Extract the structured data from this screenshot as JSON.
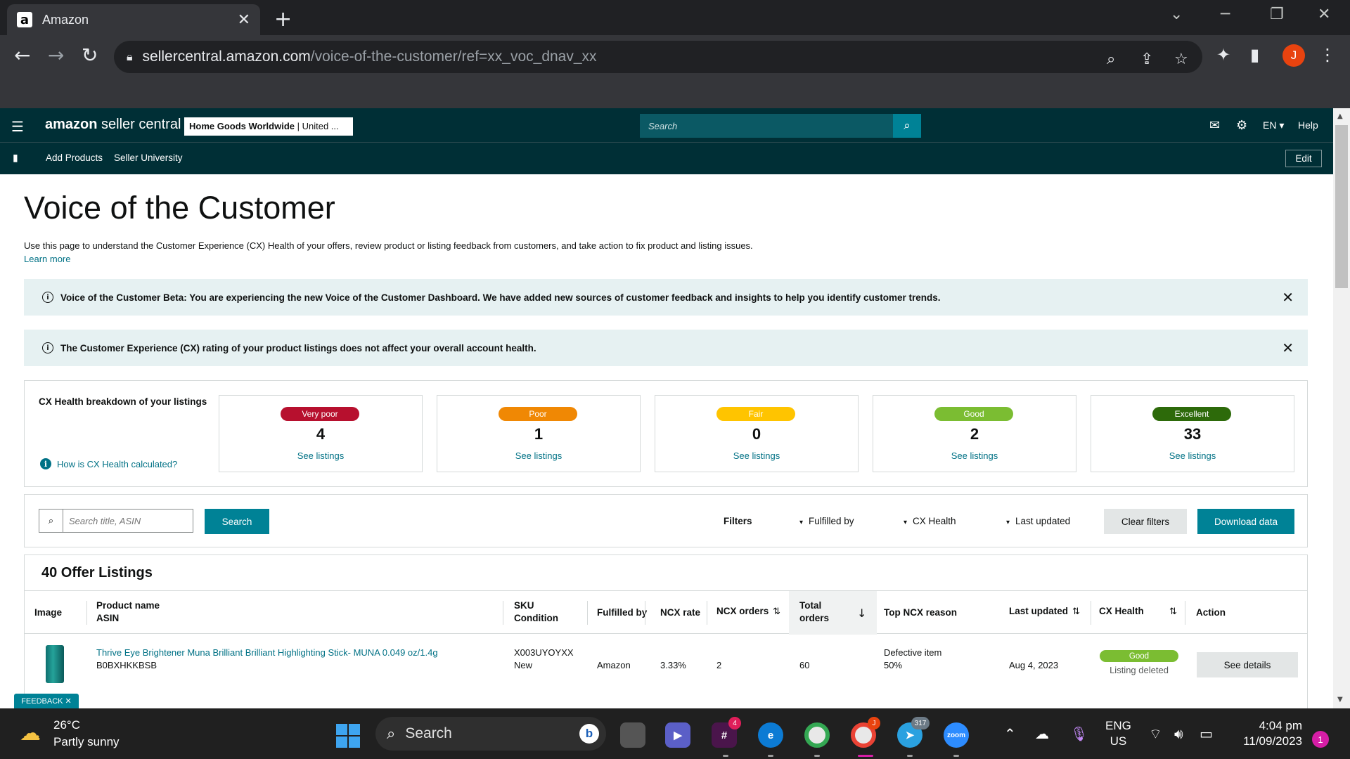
{
  "browser": {
    "tab_title": "Amazon",
    "url_host": "sellercentral.amazon.com",
    "url_path": "/voice-of-the-customer/ref=xx_voc_dnav_xx",
    "profile_initial": "J"
  },
  "header": {
    "logo_brand": "amazon",
    "logo_product": " seller central",
    "store_name": "Home Goods Worldwide",
    "store_region": " | United ...",
    "search_placeholder": "Search",
    "language": "EN",
    "help": "Help"
  },
  "nav": {
    "links": [
      "Add Products",
      "Seller University"
    ],
    "edit": "Edit"
  },
  "page": {
    "title": "Voice of the Customer",
    "description": "Use this page to understand the Customer Experience (CX) Health of your offers, review product or listing feedback from customers, and take action to fix product and listing issues.",
    "learn_more": "Learn more"
  },
  "alerts": [
    {
      "text": "Voice of the Customer Beta: You are experiencing the new Voice of the Customer Dashboard. We have added new sources of customer feedback and insights to help you identify customer trends."
    },
    {
      "text": "The Customer Experience (CX) rating of your product listings does not affect your overall account health."
    }
  ],
  "cx_health": {
    "label": "CX Health breakdown of your listings",
    "how_link": "How is CX Health calculated?",
    "buckets": [
      {
        "label": "Very poor",
        "count": "4",
        "link": "See listings",
        "color": "#b7102e"
      },
      {
        "label": "Poor",
        "count": "1",
        "link": "See listings",
        "color": "#f08804"
      },
      {
        "label": "Fair",
        "count": "0",
        "link": "See listings",
        "color": "#ffc400"
      },
      {
        "label": "Good",
        "count": "2",
        "link": "See listings",
        "color": "#7bbd32"
      },
      {
        "label": "Excellent",
        "count": "33",
        "link": "See listings",
        "color": "#2d6a0a"
      }
    ]
  },
  "filters": {
    "search_placeholder": "Search title, ASIN",
    "search_button": "Search",
    "filters_label": "Filters",
    "dropdowns": [
      "Fulfilled by",
      "CX Health",
      "Last updated"
    ],
    "clear": "Clear filters",
    "download": "Download data"
  },
  "table": {
    "title": "40 Offer Listings",
    "headers": {
      "image": "Image",
      "product_name": "Product name",
      "asin": "ASIN",
      "sku": "SKU",
      "condition": "Condition",
      "fulfilled_by": "Fulfilled by",
      "ncx_rate": "NCX rate",
      "ncx_orders": "NCX orders",
      "total": "Total",
      "orders": "orders",
      "top_reason": "Top NCX reason",
      "last_updated": "Last updated",
      "cx_health": "CX Health",
      "action": "Action"
    },
    "rows": [
      {
        "product_name": "Thrive Eye Brightener Muna Brilliant Brilliant Highlighting Stick- MUNA 0.049 oz/1.4g",
        "asin": "B0BXHKKBSB",
        "sku": "X003UYOYXX",
        "condition": "New",
        "fulfilled_by": "Amazon",
        "ncx_rate": "3.33%",
        "ncx_orders": "2",
        "total_orders": "60",
        "top_reason": "Defective item",
        "top_reason_pct": "50%",
        "last_updated": "Aug 4, 2023",
        "cx_health": "Good",
        "cx_status": "Listing deleted",
        "action": "See details"
      }
    ]
  },
  "feedback": "FEEDBACK ✕",
  "taskbar": {
    "temp": "26°C",
    "weather": "Partly sunny",
    "search": "Search",
    "slack_badge": "4",
    "telegram_badge": "317",
    "zoom_label": "zoom",
    "lang_line1": "ENG",
    "lang_line2": "US",
    "time": "4:04 pm",
    "date": "11/09/2023",
    "notifications": "1"
  }
}
